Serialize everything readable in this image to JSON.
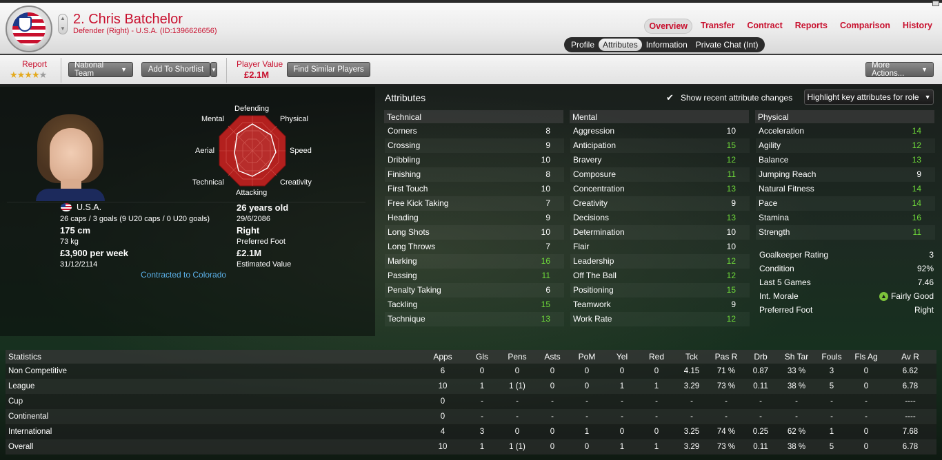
{
  "header": {
    "player_name": "2. Chris Batchelor",
    "player_sub": "Defender (Right) - U.S.A. (ID:1396626656)",
    "nav": [
      "Overview",
      "Transfer",
      "Contract",
      "Reports",
      "Comparison",
      "History"
    ],
    "subnav": [
      "Profile",
      "Attributes",
      "Information",
      "Private Chat (Int)"
    ]
  },
  "toolbar": {
    "report_label": "Report",
    "rating_stars": 3.5,
    "stars": {
      "on": "★★★",
      "half": "★",
      "off": "★"
    },
    "national_team": "National Team",
    "add_shortlist": "Add To Shortlist",
    "player_value_label": "Player Value",
    "player_value": "£2.1M",
    "find_similar": "Find Similar Players",
    "more_actions": "More Actions..."
  },
  "radar": {
    "labels": {
      "defending": "Defending",
      "physical": "Physical",
      "speed": "Speed",
      "creativity": "Creativity",
      "attacking": "Attacking",
      "technical": "Technical",
      "aerial": "Aerial",
      "mental": "Mental"
    }
  },
  "info": {
    "nation": "U.S.A.",
    "caps": "26 caps / 3 goals (9 U20 caps / 0 U20 goals)",
    "height": "175 cm",
    "weight": "73 kg",
    "wage": "£3,900 per week",
    "contract_end": "31/12/2114",
    "age": "26 years old",
    "dob": "29/6/2086",
    "foot": "Right",
    "foot_label": "Preferred Foot",
    "value": "£2.1M",
    "value_label": "Estimated Value",
    "contracted": "Contracted to Colorado"
  },
  "attributes": {
    "title": "Attributes",
    "show_changes": "Show recent attribute changes",
    "highlight": "Highlight key attributes for role",
    "technical": {
      "header": "Technical",
      "rows": [
        {
          "name": "Corners",
          "value": "8",
          "color": "white"
        },
        {
          "name": "Crossing",
          "value": "9",
          "color": "white"
        },
        {
          "name": "Dribbling",
          "value": "10",
          "color": "white"
        },
        {
          "name": "Finishing",
          "value": "8",
          "color": "white"
        },
        {
          "name": "First Touch",
          "value": "10",
          "color": "white"
        },
        {
          "name": "Free Kick Taking",
          "value": "7",
          "color": "white"
        },
        {
          "name": "Heading",
          "value": "9",
          "color": "white"
        },
        {
          "name": "Long Shots",
          "value": "10",
          "color": "white"
        },
        {
          "name": "Long Throws",
          "value": "7",
          "color": "white"
        },
        {
          "name": "Marking",
          "value": "16",
          "color": "green"
        },
        {
          "name": "Passing",
          "value": "11",
          "color": "green"
        },
        {
          "name": "Penalty Taking",
          "value": "6",
          "color": "white"
        },
        {
          "name": "Tackling",
          "value": "15",
          "color": "green"
        },
        {
          "name": "Technique",
          "value": "13",
          "color": "green"
        }
      ]
    },
    "mental": {
      "header": "Mental",
      "rows": [
        {
          "name": "Aggression",
          "value": "10",
          "color": "white"
        },
        {
          "name": "Anticipation",
          "value": "15",
          "color": "green"
        },
        {
          "name": "Bravery",
          "value": "12",
          "color": "green"
        },
        {
          "name": "Composure",
          "value": "11",
          "color": "green"
        },
        {
          "name": "Concentration",
          "value": "13",
          "color": "green"
        },
        {
          "name": "Creativity",
          "value": "9",
          "color": "white"
        },
        {
          "name": "Decisions",
          "value": "13",
          "color": "green"
        },
        {
          "name": "Determination",
          "value": "10",
          "color": "white"
        },
        {
          "name": "Flair",
          "value": "10",
          "color": "white"
        },
        {
          "name": "Leadership",
          "value": "12",
          "color": "green"
        },
        {
          "name": "Off The Ball",
          "value": "12",
          "color": "green"
        },
        {
          "name": "Positioning",
          "value": "15",
          "color": "green"
        },
        {
          "name": "Teamwork",
          "value": "9",
          "color": "white"
        },
        {
          "name": "Work Rate",
          "value": "12",
          "color": "green"
        }
      ]
    },
    "physical": {
      "header": "Physical",
      "rows": [
        {
          "name": "Acceleration",
          "value": "14",
          "color": "green"
        },
        {
          "name": "Agility",
          "value": "12",
          "color": "green"
        },
        {
          "name": "Balance",
          "value": "13",
          "color": "green"
        },
        {
          "name": "Jumping Reach",
          "value": "9",
          "color": "white"
        },
        {
          "name": "Natural Fitness",
          "value": "14",
          "color": "green"
        },
        {
          "name": "Pace",
          "value": "14",
          "color": "green"
        },
        {
          "name": "Stamina",
          "value": "16",
          "color": "green"
        },
        {
          "name": "Strength",
          "value": "11",
          "color": "green"
        }
      ]
    },
    "extra": [
      {
        "name": "Goalkeeper Rating",
        "value": "3"
      },
      {
        "name": "Condition",
        "value": "92%"
      },
      {
        "name": "Last 5 Games",
        "value": "7.46"
      },
      {
        "name": "Int. Morale",
        "value": "Fairly Good"
      },
      {
        "name": "Preferred Foot",
        "value": "Right"
      }
    ]
  },
  "statistics": {
    "columns": [
      "Statistics",
      "Apps",
      "Gls",
      "Pens",
      "Asts",
      "PoM",
      "Yel",
      "Red",
      "Tck",
      "Pas R",
      "Drb",
      "Sh Tar",
      "Fouls",
      "Fls Ag",
      "Av R"
    ],
    "rows": [
      [
        "Non Competitive",
        "6",
        "0",
        "0",
        "0",
        "0",
        "0",
        "0",
        "4.15",
        "71 %",
        "0.87",
        "33 %",
        "3",
        "0",
        "6.62"
      ],
      [
        "League",
        "10",
        "1",
        "1 (1)",
        "0",
        "0",
        "1",
        "1",
        "3.29",
        "73 %",
        "0.11",
        "38 %",
        "5",
        "0",
        "6.78"
      ],
      [
        "Cup",
        "0",
        "-",
        "-",
        "-",
        "-",
        "-",
        "-",
        "-",
        "-",
        "-",
        "-",
        "-",
        "-",
        "----"
      ],
      [
        "Continental",
        "0",
        "-",
        "-",
        "-",
        "-",
        "-",
        "-",
        "-",
        "-",
        "-",
        "-",
        "-",
        "-",
        "----"
      ],
      [
        "International",
        "4",
        "3",
        "0",
        "0",
        "1",
        "0",
        "0",
        "3.25",
        "74 %",
        "0.25",
        "62 %",
        "1",
        "0",
        "7.68"
      ],
      [
        "Overall",
        "10",
        "1",
        "1 (1)",
        "0",
        "0",
        "1",
        "1",
        "3.29",
        "73 %",
        "0.11",
        "38 %",
        "5",
        "0",
        "6.78"
      ]
    ]
  },
  "colors": {
    "accent_red": "#c8102e",
    "attr_green": "#6fdb3a",
    "link_blue": "#5bb0e8",
    "radar_fill": "#b3201e"
  }
}
